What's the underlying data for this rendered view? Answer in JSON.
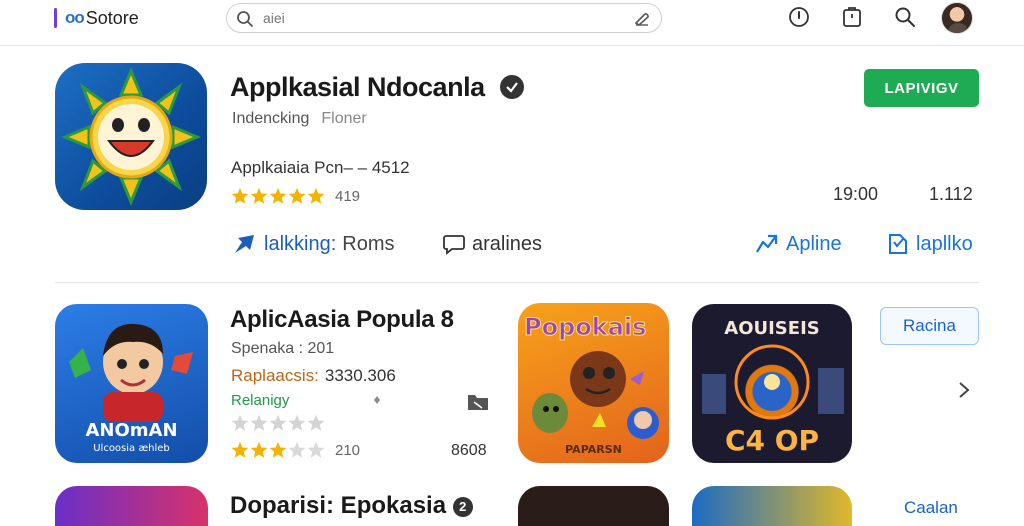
{
  "topbar": {
    "logo_mark": "oo",
    "logo_text": "Sotore",
    "search_placeholder": "aiei",
    "icons": [
      "search-icon",
      "mic-icon",
      "clock-icon",
      "bag-icon",
      "account-avatar"
    ]
  },
  "hero": {
    "icon": "sun-smiley-app-icon",
    "title": "Applkasial Ndocanla",
    "subtitle_primary": "Indencking",
    "subtitle_secondary": "Floner",
    "meta": "Applkaiaia Pcn– – 4512",
    "rating_stars": 5,
    "rating_count": "419",
    "stat_1": "19:00",
    "stat_2": "1.112",
    "install_label": "LAPIVIGV",
    "actions": [
      {
        "icon": "pin-icon",
        "label": "lalkking:",
        "rest": "Roms"
      },
      {
        "icon": "chat-icon",
        "label": "aralines"
      },
      {
        "icon": "share-icon",
        "label": "Apline"
      },
      {
        "icon": "bookmark-icon",
        "label": "lapllko"
      }
    ],
    "colors": {
      "install": "#1faa54",
      "link": "#1a74d8",
      "verified": "#333333"
    }
  },
  "section": {
    "title": "AplicAasia Popula 8",
    "line1": "Spenaka : 201",
    "line2_label": "Raplaacsis:",
    "line2_value": "3330.306",
    "line3": "Relanigy",
    "rating_stars": 3,
    "rating_max": 5,
    "rating_count": "210",
    "count_right": "8608",
    "card_icon_1": {
      "name": "boy-cartoon-app-icon",
      "top_text": "ANOmAN",
      "bottom_text": "Ulcoosia æhleb"
    },
    "card_icon_2": {
      "name": "popkais-game-icon",
      "top_text": "Popokais",
      "bottom_text": "PAPARSN"
    },
    "card_icon_3": {
      "name": "space-orb-game-icon",
      "top_text": "AOUISEIS",
      "bottom_text": "C4 OP"
    },
    "button_label": "Racina"
  },
  "peek": {
    "title": "Doparisi: Epokasia",
    "badge": "2",
    "link": "Caalan"
  }
}
